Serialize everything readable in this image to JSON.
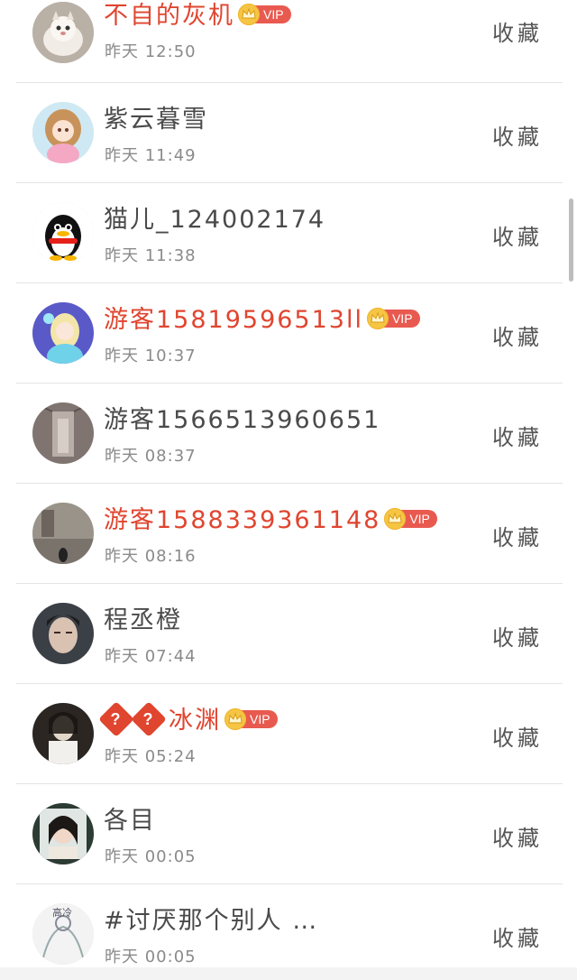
{
  "favorite_label": "收藏",
  "vip_label": "VIP",
  "colors": {
    "vip_name": "#e0452f",
    "normal_name": "#4a4a4a",
    "vip_tag": "#e85a4f",
    "crown": "#f6c544"
  },
  "items": [
    {
      "name": "不自的灰机",
      "time": "昨天 12:50",
      "vip": true,
      "avatar": "cat-avatar"
    },
    {
      "name": "紫云暮雪",
      "time": "昨天 11:49",
      "vip": false,
      "avatar": "anime-girl-avatar"
    },
    {
      "name": "猫儿_124002174",
      "time": "昨天 11:38",
      "vip": false,
      "avatar": "penguin-avatar"
    },
    {
      "name": "游客15819596513ll",
      "time": "昨天 10:37",
      "vip": true,
      "avatar": "princess-avatar"
    },
    {
      "name": "游客1566513960651",
      "time": "昨天 08:37",
      "vip": false,
      "avatar": "corridor-avatar"
    },
    {
      "name": "游客1588339361148",
      "time": "昨天 08:16",
      "vip": true,
      "avatar": "street-avatar"
    },
    {
      "name": "程丞橙",
      "time": "昨天 07:44",
      "vip": false,
      "avatar": "man-avatar"
    },
    {
      "name": "冰渊",
      "name_prefix": "??",
      "time": "昨天 05:24",
      "vip": true,
      "avatar": "dark-portrait-avatar"
    },
    {
      "name": "各目",
      "time": "昨天 00:05",
      "vip": false,
      "avatar": "woman-avatar"
    },
    {
      "name": "#讨厌那个别人 …",
      "time": "昨天 00:05",
      "vip": false,
      "avatar": "sketch-avatar"
    }
  ]
}
